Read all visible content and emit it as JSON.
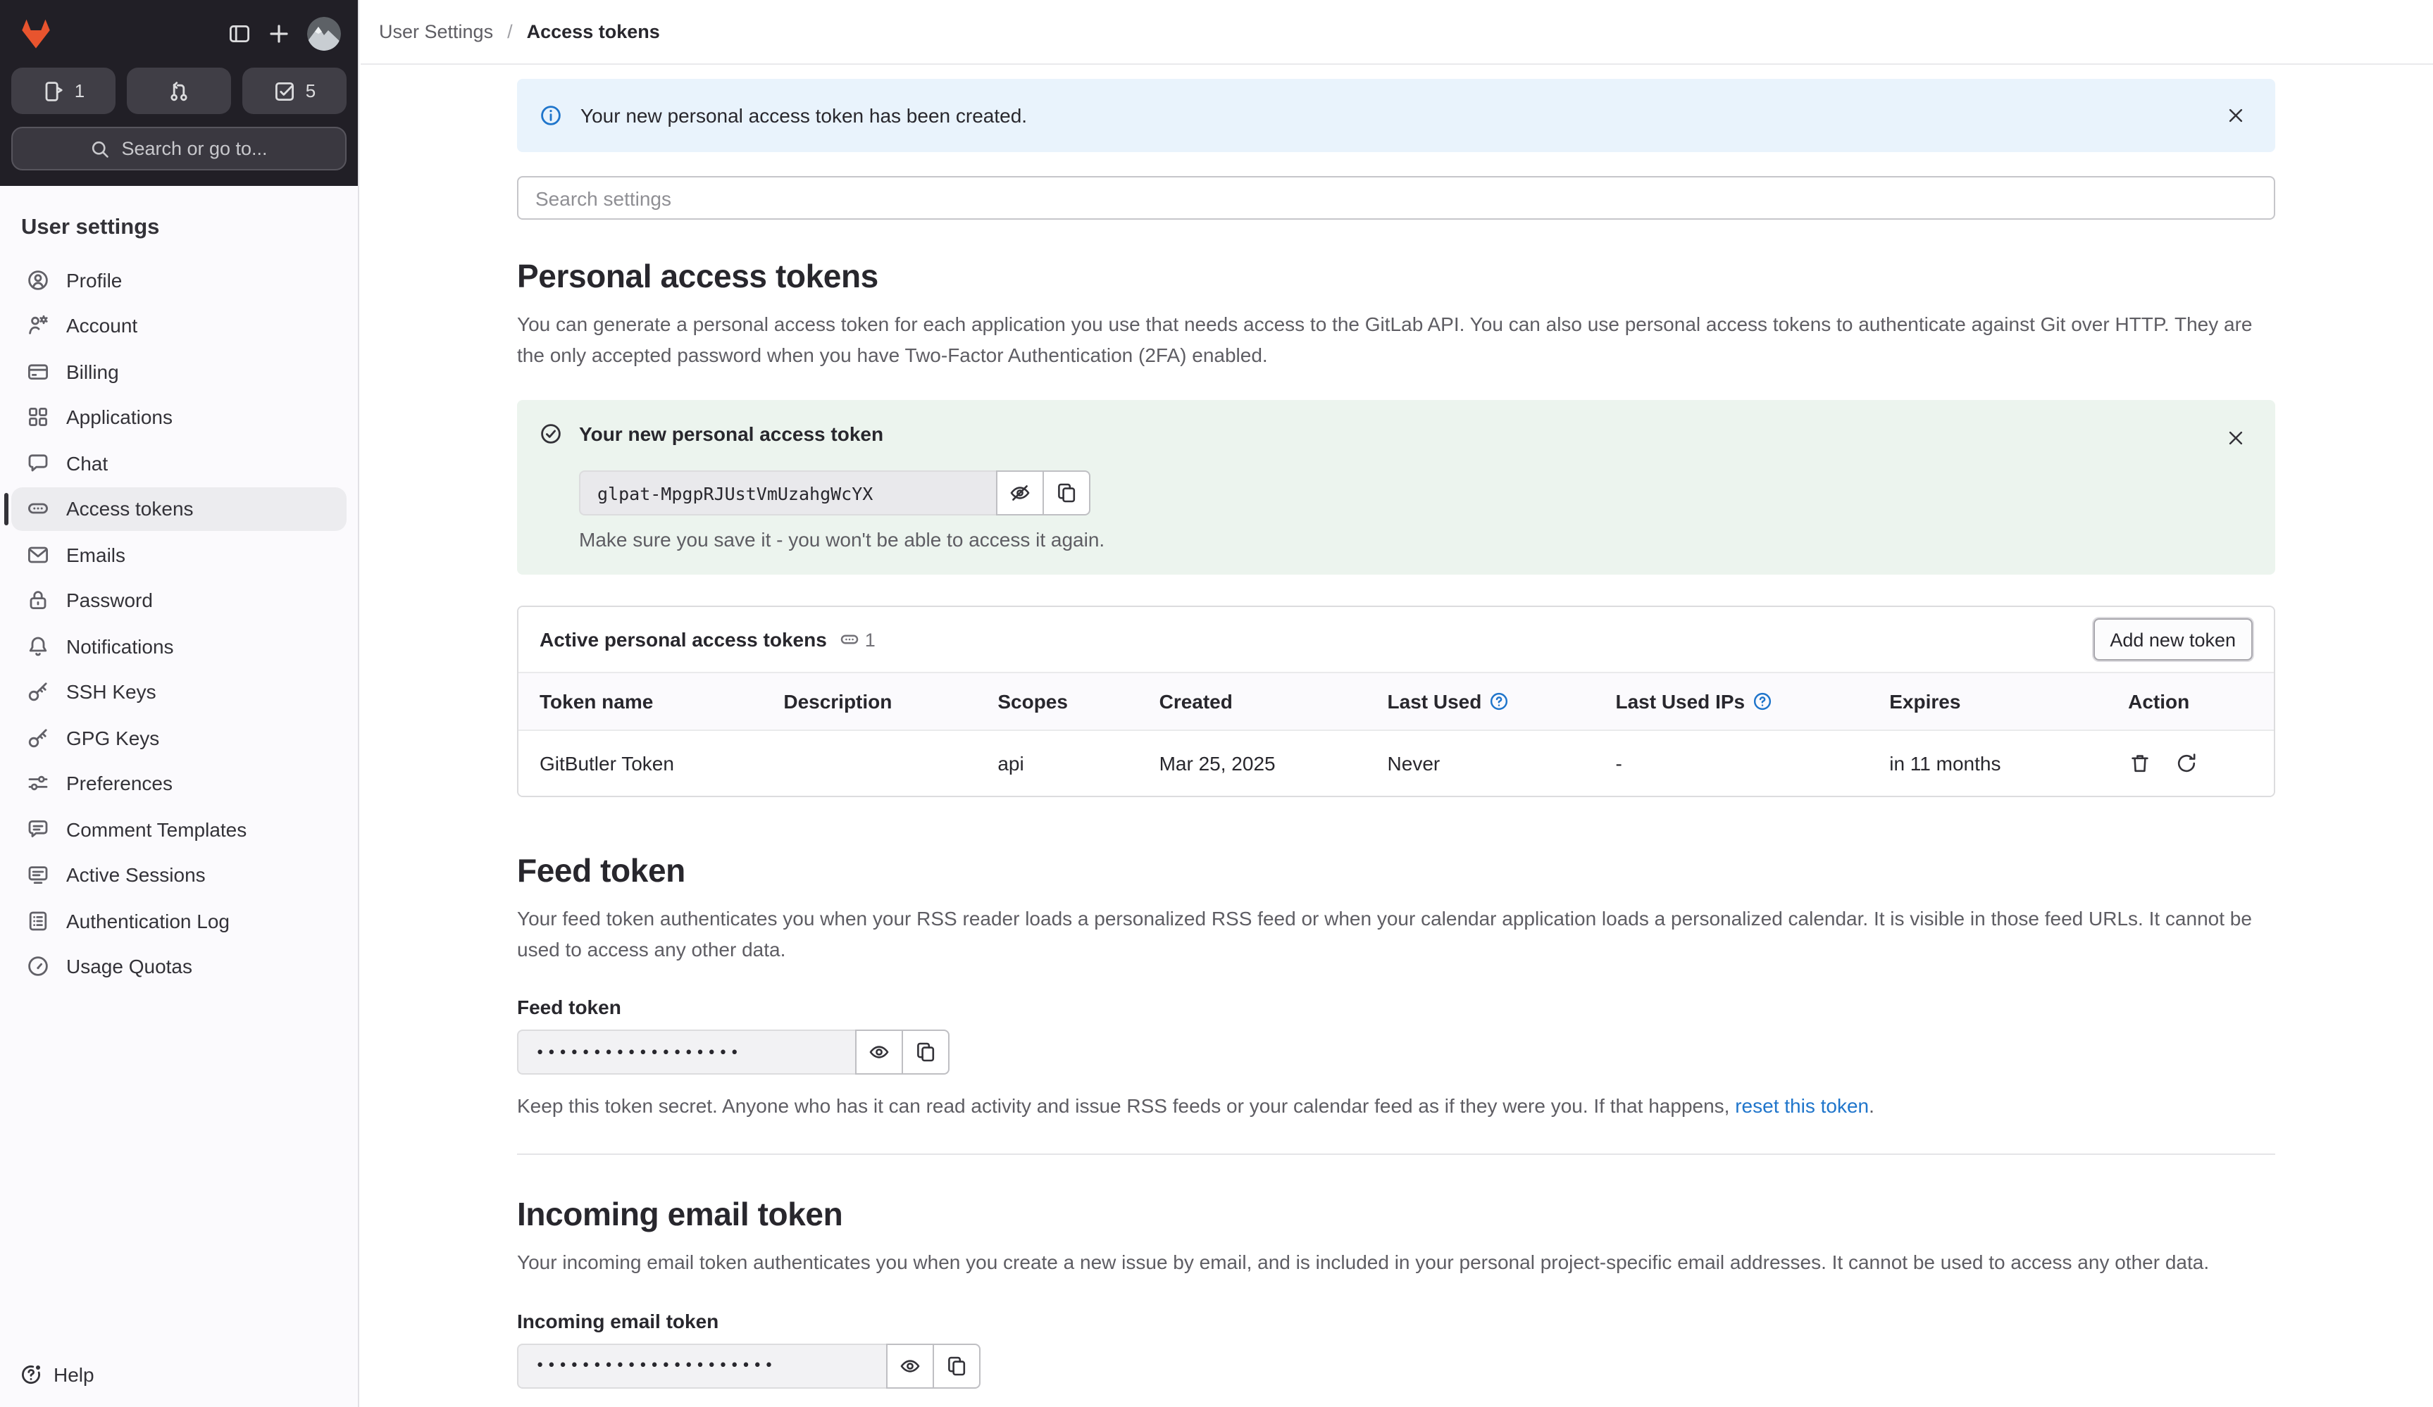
{
  "colors": {
    "brand_orange": "#e8542e",
    "sidebar_dark": "#211f26",
    "accent_blue": "#1f75cb",
    "info_bg": "#e9f3fc",
    "success_bg": "#ecf4ee",
    "active_item_bg": "#ececef"
  },
  "topbar": {
    "issues_count": "1",
    "todos_count": "5",
    "search_placeholder": "Search or go to..."
  },
  "sidebar": {
    "title": "User settings",
    "items": [
      {
        "icon": "profile-icon",
        "label": "Profile"
      },
      {
        "icon": "account-icon",
        "label": "Account"
      },
      {
        "icon": "billing-icon",
        "label": "Billing"
      },
      {
        "icon": "applications-icon",
        "label": "Applications"
      },
      {
        "icon": "chat-icon",
        "label": "Chat"
      },
      {
        "icon": "token-pill-icon",
        "label": "Access tokens"
      },
      {
        "icon": "emails-icon",
        "label": "Emails"
      },
      {
        "icon": "password-lock-icon",
        "label": "Password"
      },
      {
        "icon": "notifications-bell-icon",
        "label": "Notifications"
      },
      {
        "icon": "ssh-key-icon",
        "label": "SSH Keys"
      },
      {
        "icon": "gpg-key-icon",
        "label": "GPG Keys"
      },
      {
        "icon": "preferences-sliders-icon",
        "label": "Preferences"
      },
      {
        "icon": "comment-templates-icon",
        "label": "Comment Templates"
      },
      {
        "icon": "active-sessions-icon",
        "label": "Active Sessions"
      },
      {
        "icon": "authentication-log-icon",
        "label": "Authentication Log"
      },
      {
        "icon": "usage-quotas-icon",
        "label": "Usage Quotas"
      }
    ],
    "active_item": "Access tokens",
    "help_label": "Help"
  },
  "breadcrumb": {
    "parent": "User Settings",
    "separator": "/",
    "current": "Access tokens"
  },
  "alert": {
    "text": "Your new personal access token has been created."
  },
  "settings_search": {
    "placeholder": "Search settings"
  },
  "pat": {
    "title": "Personal access tokens",
    "description": "You can generate a personal access token for each application you use that needs access to the GitLab API. You can also use personal access tokens to authenticate against Git over HTTP. They are the only accepted password when you have Two-Factor Authentication (2FA) enabled.",
    "new_token_box": {
      "title": "Your new personal access token",
      "token_value": "glpat-MpgpRJUstVmUzahgWcYX",
      "warning": "Make sure you save it - you won't be able to access it again."
    },
    "active_tokens": {
      "title": "Active personal access tokens",
      "count": "1",
      "add_button": "Add new token",
      "columns": [
        "Token name",
        "Description",
        "Scopes",
        "Created",
        "Last Used",
        "Last Used IPs",
        "Expires",
        "Action"
      ],
      "rows": [
        {
          "token_name": "GitButler Token",
          "description": "",
          "scopes": "api",
          "created": "Mar 25, 2025",
          "last_used": "Never",
          "last_used_ips": "-",
          "expires": "in 11 months"
        }
      ]
    }
  },
  "feed_token": {
    "title": "Feed token",
    "description": "Your feed token authenticates you when your RSS reader loads a personalized RSS feed or when your calendar application loads a personalized calendar. It is visible in those feed URLs. It cannot be used to access any other data.",
    "label": "Feed token",
    "masked_value": "••••••••••••••••••",
    "note_prefix": "Keep this token secret. Anyone who has it can read activity and issue RSS feeds or your calendar feed as if they were you. If that happens, ",
    "note_link": "reset this token",
    "note_suffix": "."
  },
  "incoming_email_token": {
    "title": "Incoming email token",
    "description": "Your incoming email token authenticates you when you create a new issue by email, and is included in your personal project-specific email addresses. It cannot be used to access any other data.",
    "label": "Incoming email token",
    "masked_value": "•••••••••••••••••••••"
  }
}
